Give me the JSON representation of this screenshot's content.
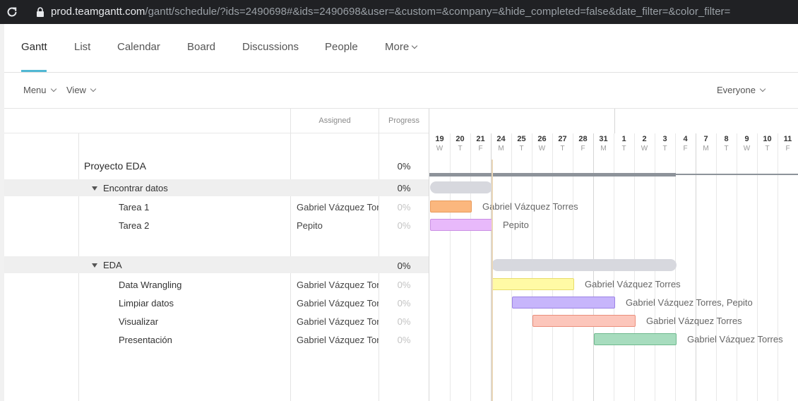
{
  "browser": {
    "url_host": "prod.teamgantt.com",
    "url_path": "/gantt/schedule/?ids=2490698#&ids=2490698&user=&custom=&company=&hide_completed=false&date_filter=&color_filter="
  },
  "tabs": {
    "gantt": "Gantt",
    "list": "List",
    "calendar": "Calendar",
    "board": "Board",
    "discussions": "Discussions",
    "people": "People",
    "more": "More"
  },
  "toolbar": {
    "menu": "Menu",
    "view": "View",
    "everyone": "Everyone"
  },
  "columns": {
    "assigned": "Assigned",
    "progress": "Progress"
  },
  "rows": {
    "project": {
      "name": "Proyecto EDA",
      "progress": "0%"
    },
    "group1": {
      "name": "Encontrar datos",
      "progress": "0%"
    },
    "task1": {
      "name": "Tarea 1",
      "assigned": "Gabriel Vázquez Torres",
      "progress": "0%",
      "label": "Gabriel Vázquez Torres"
    },
    "task2": {
      "name": "Tarea 2",
      "assigned": "Pepito",
      "progress": "0%",
      "label": "Pepito"
    },
    "group2": {
      "name": "EDA",
      "progress": "0%"
    },
    "task3": {
      "name": "Data Wrangling",
      "assigned": "Gabriel Vázquez Torres",
      "progress": "0%",
      "label": "Gabriel Vázquez Torres"
    },
    "task4": {
      "name": "Limpiar datos",
      "assigned": "Gabriel Vázquez Torres",
      "progress": "0%",
      "label": "Gabriel Vázquez Torres, Pepito"
    },
    "task5": {
      "name": "Visualizar",
      "assigned": "Gabriel Vázquez Torres",
      "progress": "0%",
      "label": "Gabriel Vázquez Torres"
    },
    "task6": {
      "name": "Presentación",
      "assigned": "Gabriel Vázquez Torres",
      "progress": "0%",
      "label": "Gabriel Vázquez Torres"
    }
  },
  "days": [
    {
      "n": "19",
      "d": "W"
    },
    {
      "n": "20",
      "d": "T"
    },
    {
      "n": "21",
      "d": "F"
    },
    {
      "n": "24",
      "d": "M"
    },
    {
      "n": "25",
      "d": "T"
    },
    {
      "n": "26",
      "d": "W"
    },
    {
      "n": "27",
      "d": "T"
    },
    {
      "n": "28",
      "d": "F"
    },
    {
      "n": "31",
      "d": "M"
    },
    {
      "n": "1",
      "d": "T"
    },
    {
      "n": "2",
      "d": "W"
    },
    {
      "n": "3",
      "d": "T"
    },
    {
      "n": "4",
      "d": "F"
    },
    {
      "n": "7",
      "d": "M"
    },
    {
      "n": "8",
      "d": "T"
    },
    {
      "n": "9",
      "d": "W"
    },
    {
      "n": "10",
      "d": "T"
    },
    {
      "n": "11",
      "d": "F"
    }
  ],
  "colors": {
    "accent": "#51b8d4",
    "task1": "#fbb77e",
    "task2": "#e8b9fb",
    "task3": "#fffaa5",
    "task4": "#c7b5fb",
    "task5": "#fcc6bb",
    "task6": "#a7dcbe"
  }
}
